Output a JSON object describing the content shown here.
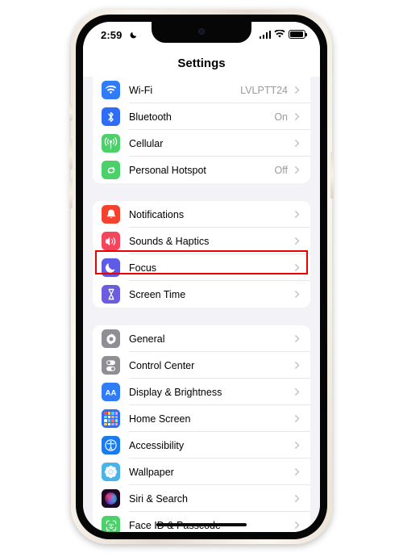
{
  "device": {
    "frame_color": "#efe7dc",
    "bezel_color": "#060606",
    "screen_bg": "#f2f2f7"
  },
  "status_bar": {
    "time": "2:59",
    "dnd_icon": "crescent-moon-icon",
    "signal_icon": "cellular-signal-icon",
    "wifi_icon": "wifi-icon",
    "battery_icon": "battery-full-icon"
  },
  "nav": {
    "title": "Settings"
  },
  "highlight": {
    "target": "Focus",
    "color": "#ee0000"
  },
  "groups": [
    {
      "id": "connectivity",
      "rows": [
        {
          "label": "Wi-Fi",
          "value": "LVLPTT24",
          "icon": "wifi-icon",
          "icon_color": "#2f7cf6"
        },
        {
          "label": "Bluetooth",
          "value": "On",
          "icon": "bluetooth-icon",
          "icon_color": "#2f6df6"
        },
        {
          "label": "Cellular",
          "value": "",
          "icon": "cellular-antenna-icon",
          "icon_color": "#4cd06a"
        },
        {
          "label": "Personal Hotspot",
          "value": "Off",
          "icon": "hotspot-link-icon",
          "icon_color": "#4cd06a"
        }
      ]
    },
    {
      "id": "alerts",
      "rows": [
        {
          "label": "Notifications",
          "value": "",
          "icon": "bell-icon",
          "icon_color": "#f4422e"
        },
        {
          "label": "Sounds & Haptics",
          "value": "",
          "icon": "speaker-icon",
          "icon_color": "#f3455c"
        },
        {
          "label": "Focus",
          "value": "",
          "icon": "moon-icon",
          "icon_color": "#5e5ce6"
        },
        {
          "label": "Screen Time",
          "value": "",
          "icon": "hourglass-icon",
          "icon_color": "#6c5ce0"
        }
      ]
    },
    {
      "id": "system",
      "rows": [
        {
          "label": "Display & Brightness",
          "value": "",
          "icon": "text-size-icon",
          "icon_color": "#2f7cf6"
        },
        {
          "label": "General",
          "value": "",
          "icon": "gear-icon",
          "icon_color": "#8e8e93"
        },
        {
          "label": "Control Center",
          "value": "",
          "icon": "toggles-icon",
          "icon_color": "#8e8e93"
        },
        {
          "label": "Home Screen",
          "value": "",
          "icon": "app-grid-icon",
          "icon_color": "#2f6df6"
        },
        {
          "label": "Accessibility",
          "value": "",
          "icon": "accessibility-icon",
          "icon_color": "#1a7bf0"
        },
        {
          "label": "Wallpaper",
          "value": "",
          "icon": "flower-icon",
          "icon_color": "#4bb3e6"
        },
        {
          "label": "Siri & Search",
          "value": "",
          "icon": "siri-orb-icon",
          "icon_color": "#2a1030"
        },
        {
          "label": "Face ID & Passcode",
          "value": "",
          "icon": "face-id-icon",
          "icon_color": "#4cd06a"
        }
      ]
    }
  ]
}
